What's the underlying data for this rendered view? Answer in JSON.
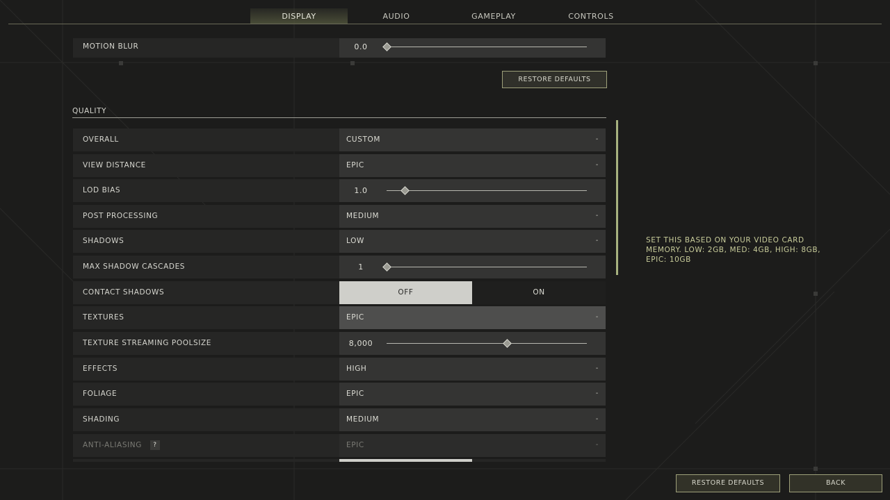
{
  "tabs": [
    {
      "label": "DISPLAY",
      "active": true
    },
    {
      "label": "AUDIO",
      "active": false
    },
    {
      "label": "GAMEPLAY",
      "active": false
    },
    {
      "label": "CONTROLS",
      "active": false
    }
  ],
  "motion_blur": {
    "label": "MOTION BLUR",
    "value": "0.0",
    "fraction": 0.0
  },
  "restore_defaults_section": "RESTORE DEFAULTS",
  "quality": {
    "title": "QUALITY",
    "rows": [
      {
        "label": "OVERALL",
        "type": "dropdown",
        "value": "CUSTOM"
      },
      {
        "label": "VIEW DISTANCE",
        "type": "dropdown",
        "value": "EPIC"
      },
      {
        "label": "LOD BIAS",
        "type": "slider",
        "value": "1.0",
        "fraction": 0.09
      },
      {
        "label": "POST PROCESSING",
        "type": "dropdown",
        "value": "MEDIUM"
      },
      {
        "label": "SHADOWS",
        "type": "dropdown",
        "value": "LOW"
      },
      {
        "label": "MAX SHADOW CASCADES",
        "type": "slider",
        "value": "1",
        "fraction": 0.0
      },
      {
        "label": "CONTACT SHADOWS",
        "type": "toggle",
        "off_label": "OFF",
        "on_label": "ON",
        "selected": "OFF"
      },
      {
        "label": "TEXTURES",
        "type": "dropdown",
        "value": "EPIC",
        "highlighted": true
      },
      {
        "label": "TEXTURE STREAMING POOLSIZE",
        "type": "slider",
        "value": "8,000",
        "fraction": 0.6
      },
      {
        "label": "EFFECTS",
        "type": "dropdown",
        "value": "HIGH"
      },
      {
        "label": "FOLIAGE",
        "type": "dropdown",
        "value": "EPIC"
      },
      {
        "label": "SHADING",
        "type": "dropdown",
        "value": "MEDIUM"
      },
      {
        "label": "ANTI-ALIASING",
        "type": "dropdown",
        "value": "EPIC",
        "disabled": true,
        "help_badge": "?"
      }
    ]
  },
  "dropdown_caret": "-",
  "help_text": "SET THIS BASED ON YOUR VIDEO CARD MEMORY. LOW: 2GB, MED: 4GB, HIGH: 8GB, EPIC: 10GB",
  "footer": {
    "restore_defaults": "RESTORE DEFAULTS",
    "back": "BACK"
  },
  "colors": {
    "background": "#1c1c1b",
    "accent": "#b9c08a",
    "help_text": "#c8cc9a"
  }
}
